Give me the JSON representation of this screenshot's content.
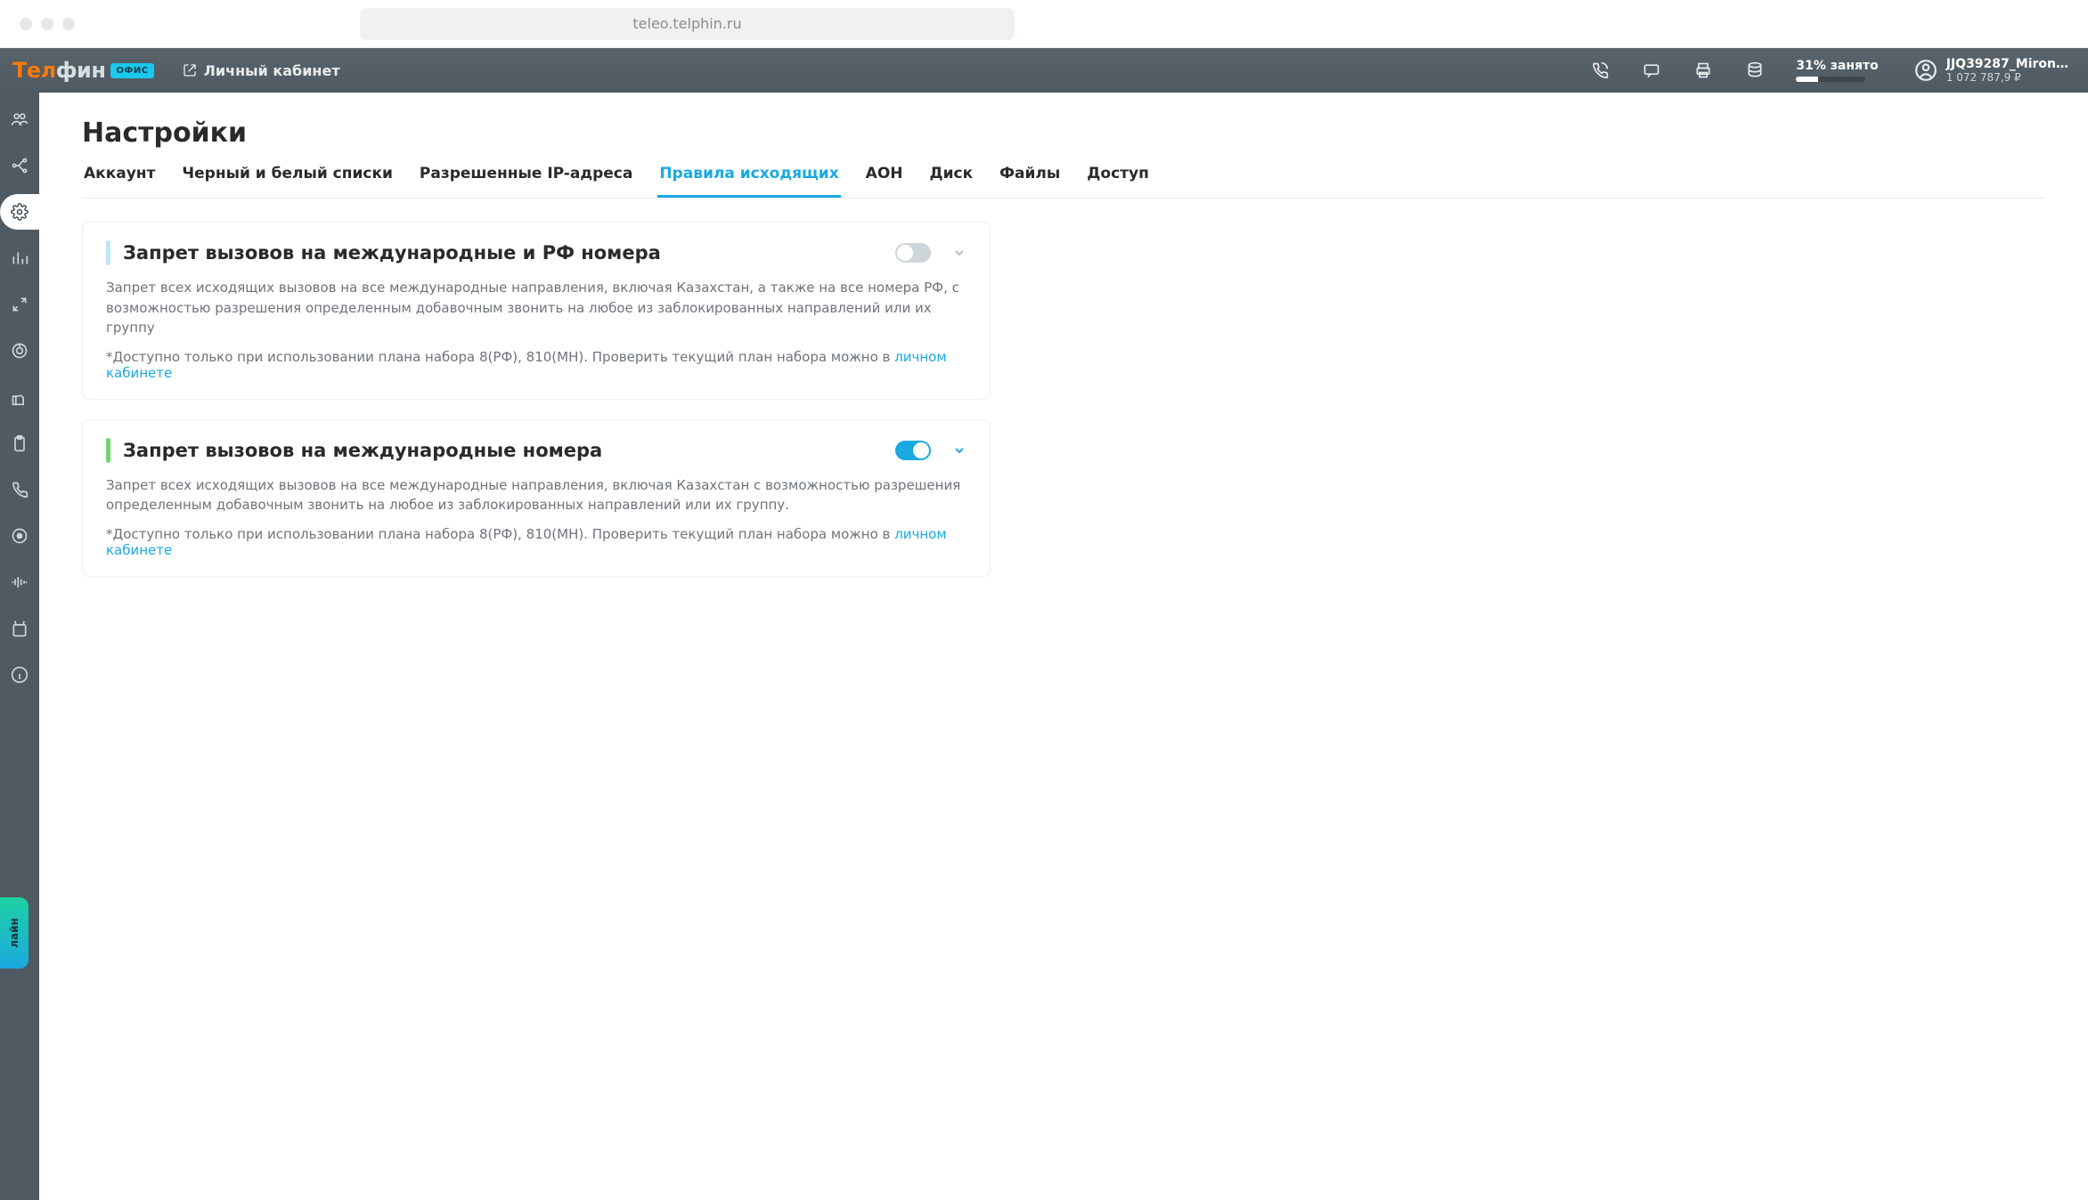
{
  "browser": {
    "url": "teleo.telphin.ru"
  },
  "topbar": {
    "logo": "Телфин",
    "logo_badge": "ОФИС",
    "personal_area": "Личный кабинет",
    "storage_label": "31% занято",
    "storage_pct": 31,
    "user_name": "JJQ39287_Miron…",
    "user_balance": "1 072 787,9 ₽"
  },
  "page": {
    "title": "Настройки",
    "tabs": [
      {
        "id": "account",
        "label": "Аккаунт"
      },
      {
        "id": "bwlists",
        "label": "Черный и белый списки"
      },
      {
        "id": "iplist",
        "label": "Разрешенные IP-адреса"
      },
      {
        "id": "outrules",
        "label": "Правила исходящих",
        "active": true
      },
      {
        "id": "aon",
        "label": "АОН"
      },
      {
        "id": "disk",
        "label": "Диск"
      },
      {
        "id": "files",
        "label": "Файлы"
      },
      {
        "id": "access",
        "label": "Доступ"
      }
    ]
  },
  "settings": {
    "card1": {
      "title": "Запрет вызовов на международные и РФ номера",
      "desc": "Запрет всех исходящих вызовов на все международные направления, включая Казахстан, а также на все номера РФ, с возможностью разрешения определенным добавочным звонить на любое из заблокированных направлений или их группу",
      "note_prefix": "*Доступно только при использовании плана набора 8(РФ), 810(МН). Проверить текущий план набора можно в ",
      "link": "личном кабинете",
      "enabled": false
    },
    "card2": {
      "title": "Запрет вызовов на международные номера",
      "desc": "Запрет всех исходящих вызовов на все международные направления, включая Казахстан с возможностью разрешения определенным добавочным звонить на любое из заблокированных направлений или их группу.",
      "note_prefix": "*Доступно только при использовании плана набора 8(РФ), 810(МН). Проверить текущий план набора можно в ",
      "link": "личном кабинете",
      "enabled": true
    }
  },
  "online_tab": "лайн"
}
